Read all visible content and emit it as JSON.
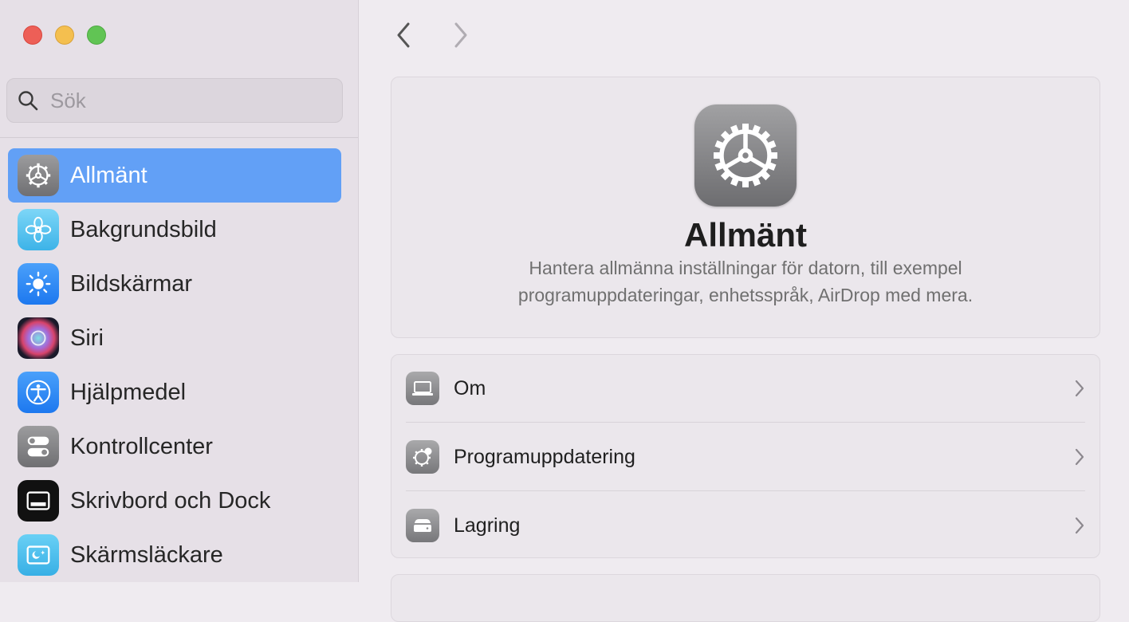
{
  "window": {
    "controls": [
      "close",
      "minimize",
      "maximize"
    ]
  },
  "search": {
    "placeholder": "Sök",
    "icon": "magnifier-icon"
  },
  "sidebar": {
    "items": [
      {
        "label": "Allmänt",
        "icon": "gear-icon",
        "color": "#8e8e90",
        "selected": true
      },
      {
        "label": "Bakgrundsbild",
        "icon": "flower-icon",
        "color": "#5cc3ef"
      },
      {
        "label": "Bildskärmar",
        "icon": "sun-icon",
        "color": "#2f86f2"
      },
      {
        "label": "Siri",
        "icon": "siri-icon",
        "color": "#a56ad8"
      },
      {
        "label": "Hjälpmedel",
        "icon": "accessibility-icon",
        "color": "#2f86f2"
      },
      {
        "label": "Kontrollcenter",
        "icon": "toggles-icon",
        "color": "#8e8e90"
      },
      {
        "label": "Skrivbord och Dock",
        "icon": "dock-icon",
        "color": "#111111"
      },
      {
        "label": "Skärmsläckare",
        "icon": "screensaver-icon",
        "color": "#4fbeec"
      }
    ],
    "selected_color": "#62a0f6"
  },
  "toolbar": {
    "back": "chevron-left-icon",
    "forward": "chevron-right-icon"
  },
  "main": {
    "title": "Allmänt",
    "description": "Hantera allmänna inställningar för datorn, till exempel programuppdateringar, enhetsspråk, AirDrop med mera.",
    "rows": [
      {
        "label": "Om",
        "icon": "laptop-icon"
      },
      {
        "label": "Programuppdatering",
        "icon": "gear-badge-icon"
      },
      {
        "label": "Lagring",
        "icon": "drive-icon"
      }
    ]
  }
}
